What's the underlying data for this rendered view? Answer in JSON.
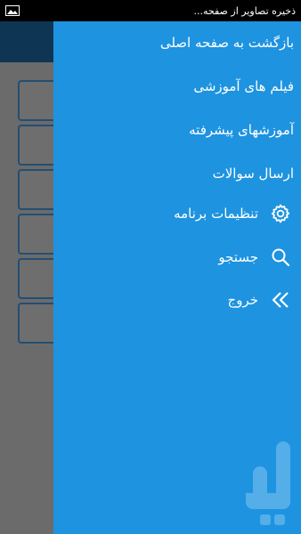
{
  "status_bar": {
    "notification_text": "ذخیره تصاویر از صفحه...",
    "notification_icon": "gallery-icon"
  },
  "drawer": {
    "background_color": "#1e93e0",
    "items": [
      {
        "label": "بازگشت به صفحه اصلی",
        "icon": null
      },
      {
        "label": "فیلم های آموزشی",
        "icon": null
      },
      {
        "label": "آموزشهای پیشرفته",
        "icon": null
      },
      {
        "label": "ارسال سوالات",
        "icon": null
      },
      {
        "label": "تنظیمات برنامه",
        "icon": "gear-icon"
      },
      {
        "label": "جستجو",
        "icon": "search-icon"
      },
      {
        "label": "خروج",
        "icon": "double-chevron-left-icon"
      }
    ]
  },
  "background": {
    "header_color": "#0f3554",
    "list_color": "#6b6b6b"
  }
}
